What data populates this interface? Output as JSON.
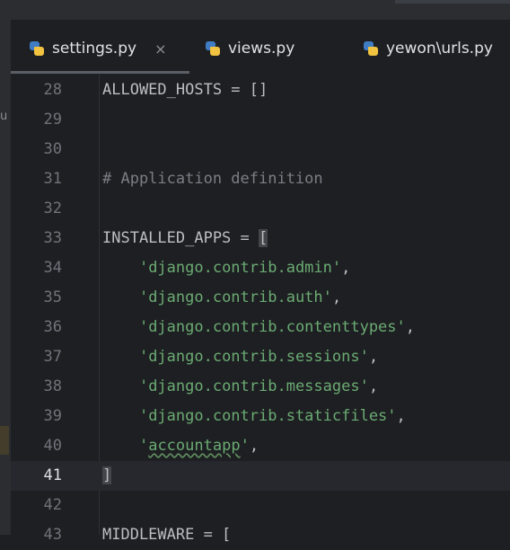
{
  "tabs": [
    {
      "label": "settings.py",
      "active": true,
      "close": "×"
    },
    {
      "label": "views.py",
      "active": false
    },
    {
      "label": "yewon\\urls.py",
      "active": false
    }
  ],
  "editor": {
    "lines": [
      {
        "num": "28",
        "text": "ALLOWED_HOSTS = []"
      },
      {
        "num": "29",
        "text": ""
      },
      {
        "num": "30",
        "text": ""
      },
      {
        "num": "31",
        "text": "# Application definition"
      },
      {
        "num": "32",
        "text": ""
      },
      {
        "num": "33",
        "text": "INSTALLED_APPS = ["
      },
      {
        "num": "34",
        "text": "    'django.contrib.admin',"
      },
      {
        "num": "35",
        "text": "    'django.contrib.auth',"
      },
      {
        "num": "36",
        "text": "    'django.contrib.contenttypes',"
      },
      {
        "num": "37",
        "text": "    'django.contrib.sessions',"
      },
      {
        "num": "38",
        "text": "    'django.contrib.messages',"
      },
      {
        "num": "39",
        "text": "    'django.contrib.staticfiles',"
      },
      {
        "num": "40",
        "text": "    'accountapp',"
      },
      {
        "num": "41",
        "text": "]"
      },
      {
        "num": "42",
        "text": ""
      },
      {
        "num": "43",
        "text": "MIDDLEWARE = ["
      }
    ]
  },
  "colors": {
    "string": "#6aab73",
    "comment": "#7a7e85",
    "text": "#bcbec4",
    "background": "#1e1f22"
  },
  "icons": {
    "tab_file": "python-icon"
  }
}
